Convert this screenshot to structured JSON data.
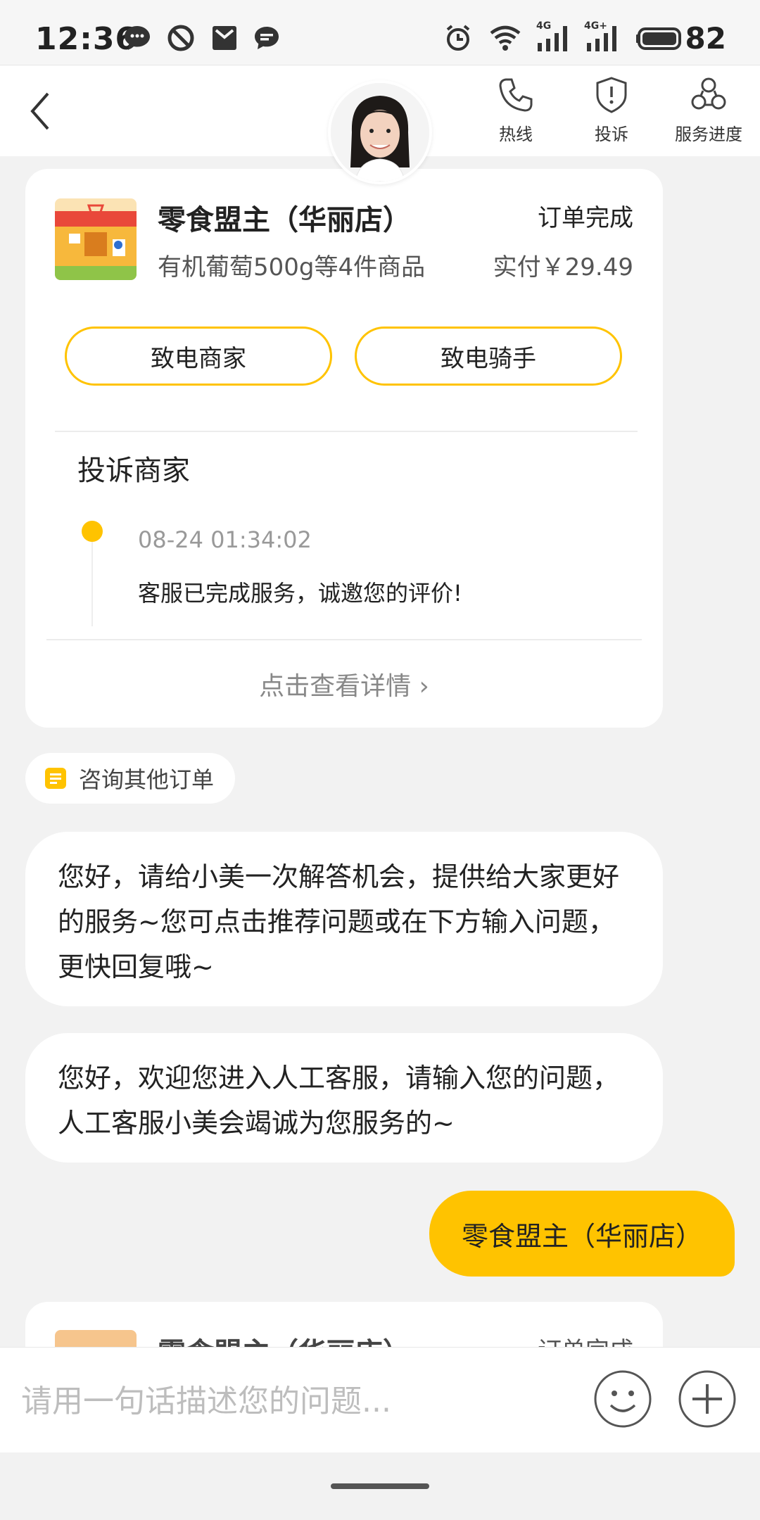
{
  "status_bar": {
    "time": "12:36",
    "battery": "82",
    "icons": [
      "chat-bubble-icon",
      "block-icon",
      "mail-icon",
      "message-icon",
      "alarm-icon",
      "wifi-icon",
      "signal-4g-icon",
      "signal-4g-plus-icon",
      "battery-icon"
    ],
    "net_labels": [
      "4G",
      "4G+"
    ]
  },
  "nav": {
    "back_icon": "chevron-left-icon",
    "actions": [
      {
        "label": "热线",
        "icon": "phone-icon"
      },
      {
        "label": "投诉",
        "icon": "shield-alert-icon"
      },
      {
        "label": "服务进度",
        "icon": "progress-icon"
      }
    ]
  },
  "order_card": {
    "shop_name": "零食盟主（华丽店）",
    "status": "订单完成",
    "goods": "有机葡萄500g等4件商品",
    "paid": "实付￥29.49",
    "call_merchant": "致电商家",
    "call_rider": "致电骑手",
    "complaint_title": "投诉商家",
    "timeline": [
      {
        "time": "08-24 01:34:02",
        "text": "客服已完成服务，诚邀您的评价!"
      }
    ],
    "detail_link": "点击查看详情 ›"
  },
  "consult_chip": {
    "label": "咨询其他订单"
  },
  "messages": [
    {
      "side": "left",
      "text": "您好，请给小美一次解答机会，提供给大家更好的服务~您可点击推荐问题或在下方输入问题，更快回复哦~"
    },
    {
      "side": "left",
      "text": "您好，欢迎您进入人工客服，请输入您的问题，人工客服小美会竭诚为您服务的~"
    },
    {
      "side": "right",
      "text": "零食盟主（华丽店）"
    }
  ],
  "partial_card": {
    "shop_name": "零食盟主（华丽店）",
    "status": "订单完成"
  },
  "input": {
    "placeholder": "请用一句话描述您的问题..."
  },
  "colors": {
    "accent": "#ffc300",
    "background": "#f2f2f2"
  }
}
